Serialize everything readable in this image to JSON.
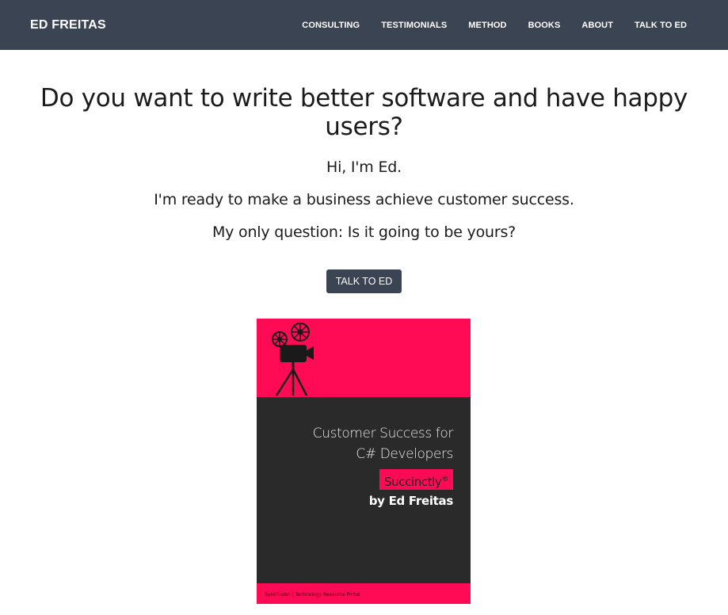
{
  "navbar": {
    "brand": "ED FREITAS",
    "links": [
      "CONSULTING",
      "TESTIMONIALS",
      "METHOD",
      "BOOKS",
      "ABOUT",
      "TALK TO ED"
    ]
  },
  "hero": {
    "headline": "Do you want to write better software and have happy users?",
    "line1": "Hi, I'm Ed.",
    "line2": "I'm ready to make a business achieve customer success.",
    "line3": "My only question: Is it going to be yours?",
    "cta_label": "TALK TO ED"
  },
  "book": {
    "title_line1": "Customer Success for",
    "title_line2": "C# Developers",
    "series": "Succinctly",
    "series_mark": "®",
    "author": "by Ed Freitas",
    "publisher": "Syncfusion  |  Technology Resource Portal",
    "icon": "film-camera-icon",
    "colors": {
      "accent": "#ff0a54",
      "cover": "#2a2a2a"
    }
  },
  "colors": {
    "nav": "#3b4452",
    "text": "#1b1b1b"
  }
}
